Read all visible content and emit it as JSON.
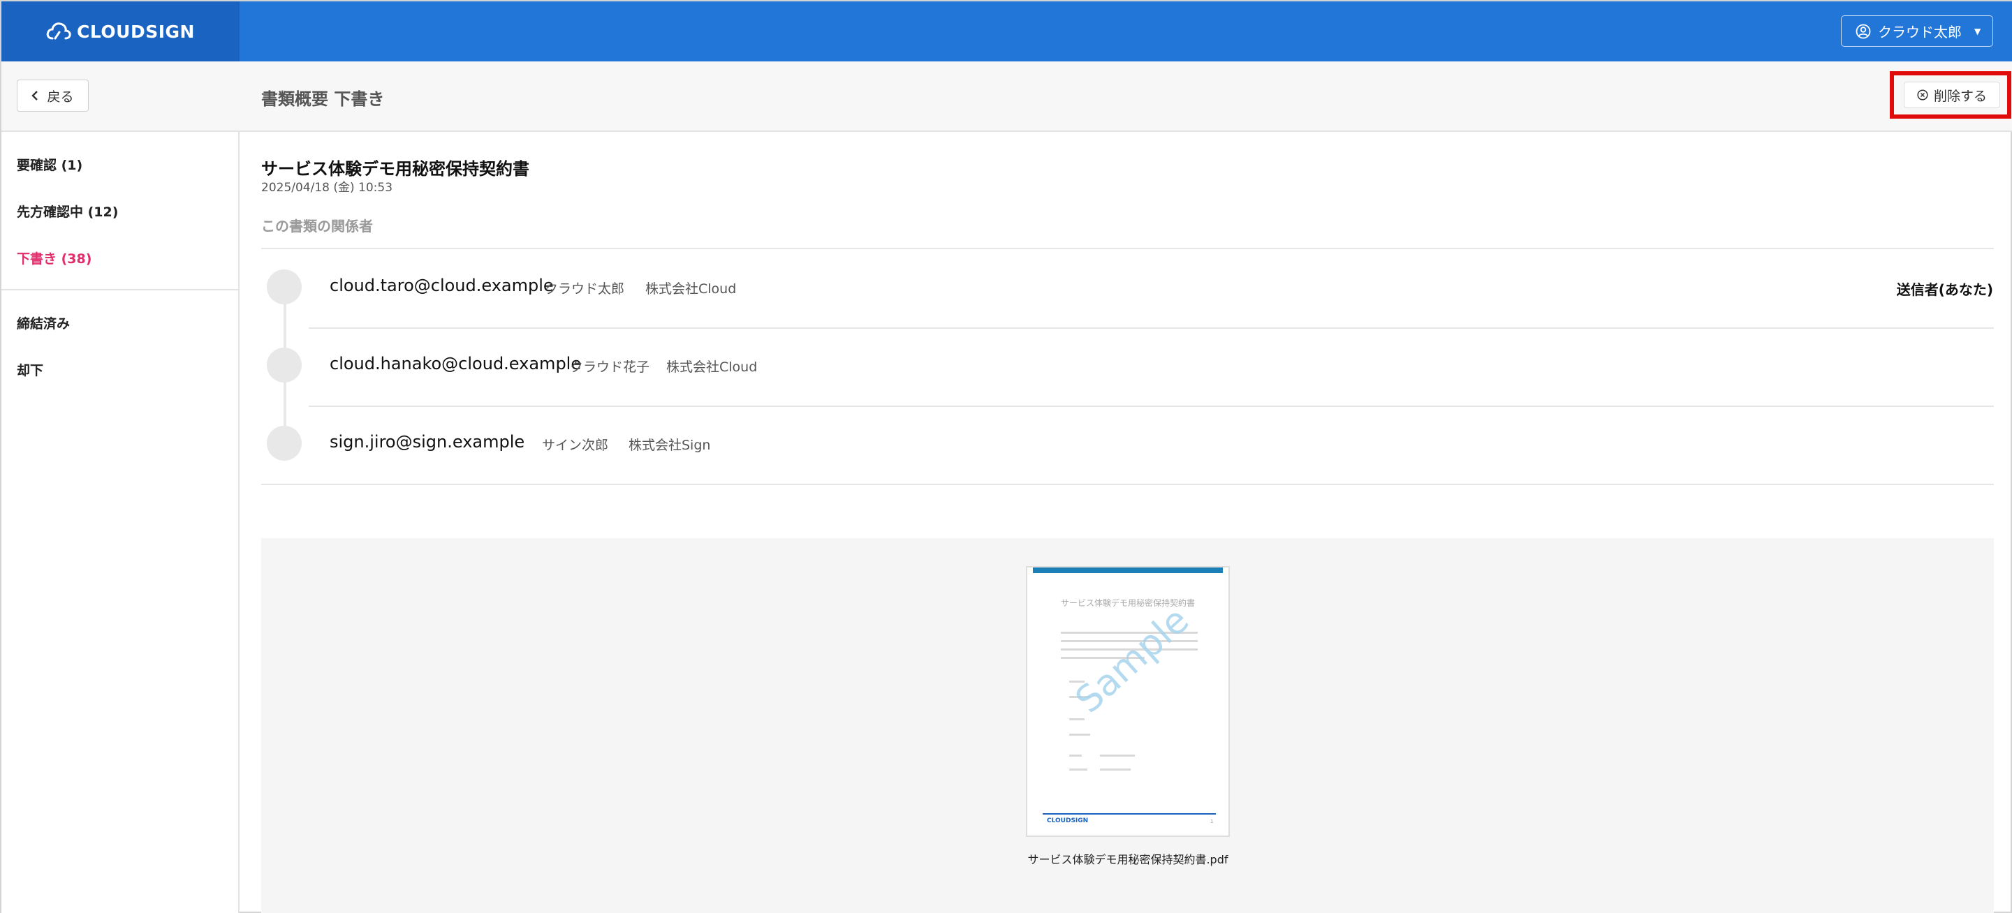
{
  "header": {
    "logo_text": "CLOUDSIGN",
    "user_name": "クラウド太郎",
    "brand_color": "#2176d8"
  },
  "toolbar": {
    "back_label": "戻る",
    "page_title": "書類概要 下書き",
    "delete_label": "削除する"
  },
  "sidebar": {
    "items": [
      {
        "label": "要確認 (1)"
      },
      {
        "label": "先方確認中 (12)"
      },
      {
        "label": "下書き (38)",
        "active": true
      },
      {
        "label": "締結済み"
      },
      {
        "label": "却下"
      }
    ]
  },
  "document": {
    "title": "サービス体験デモ用秘密保持契約書",
    "date": "2025/04/18 (金) 10:53",
    "parties_heading": "この書類の関係者",
    "parties": [
      {
        "email": "cloud.taro@cloud.example",
        "name": "クラウド太郎",
        "company": "株式会社Cloud",
        "role": "送信者(あなた)"
      },
      {
        "email": "cloud.hanako@cloud.example",
        "name": "クラウド花子",
        "company": "株式会社Cloud",
        "role": ""
      },
      {
        "email": "sign.jiro@sign.example",
        "name": "サイン次郎",
        "company": "株式会社Sign",
        "role": ""
      }
    ],
    "preview": {
      "page_title": "サービス体験デモ用秘密保持契約書",
      "watermark": "Sample",
      "footer_logo": "CLOUDSIGN",
      "page_number": "1",
      "file_name": "サービス体験デモ用秘密保持契約書.pdf"
    }
  }
}
